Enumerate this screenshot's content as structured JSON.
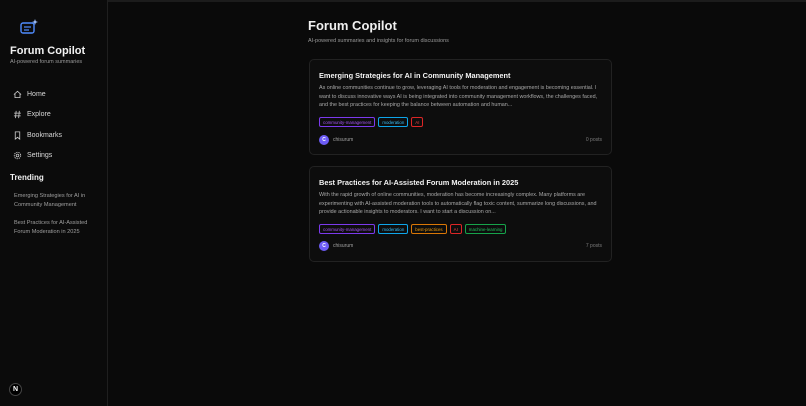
{
  "app": {
    "title": "Forum Copilot",
    "subtitle": "AI-powered forum summaries",
    "logo_icon": "chat-sparkle-icon"
  },
  "nav": [
    {
      "label": "Home",
      "icon": "home-icon"
    },
    {
      "label": "Explore",
      "icon": "hash-icon"
    },
    {
      "label": "Bookmarks",
      "icon": "bookmark-icon"
    },
    {
      "label": "Settings",
      "icon": "gear-icon"
    }
  ],
  "trending": {
    "title": "Trending",
    "items": [
      "Emerging Strategies for AI in Community Management",
      "Best Practices for AI-Assisted Forum Moderation in 2025"
    ]
  },
  "main": {
    "title": "Forum Copilot",
    "subtitle": "AI-powered summaries and insights for forum discussions"
  },
  "posts": [
    {
      "title": "Emerging Strategies for AI in Community Management",
      "excerpt": "As online communities continue to grow, leveraging AI tools for moderation and engagement is becoming essential. I want to discuss innovative ways AI is being integrated into community management workflows, the challenges faced, and the best practices for keeping the balance between automation and human...",
      "tags": [
        "community-management",
        "moderation",
        "AI"
      ],
      "author": "chisurum",
      "author_initial": "C",
      "posts_count": "0 posts"
    },
    {
      "title": "Best Practices for AI-Assisted Forum Moderation in 2025",
      "excerpt": "With the rapid growth of online communities, moderation has become increasingly complex. Many platforms are experimenting with AI-assisted moderation tools to automatically flag toxic content, summarize long discussions, and provide actionable insights to moderators. I want to start a discussion on...",
      "tags": [
        "community-management",
        "moderation",
        "best-practices",
        "AI",
        "machine-learning"
      ],
      "author": "chisurum",
      "author_initial": "C",
      "posts_count": "7 posts"
    }
  ],
  "tag_colors": {
    "community-management": "#a855f7",
    "moderation": "#38bdf8",
    "AI": "#ef4444",
    "best-practices": "#f59e0b",
    "machine-learning": "#22c55e"
  },
  "badge": "N"
}
